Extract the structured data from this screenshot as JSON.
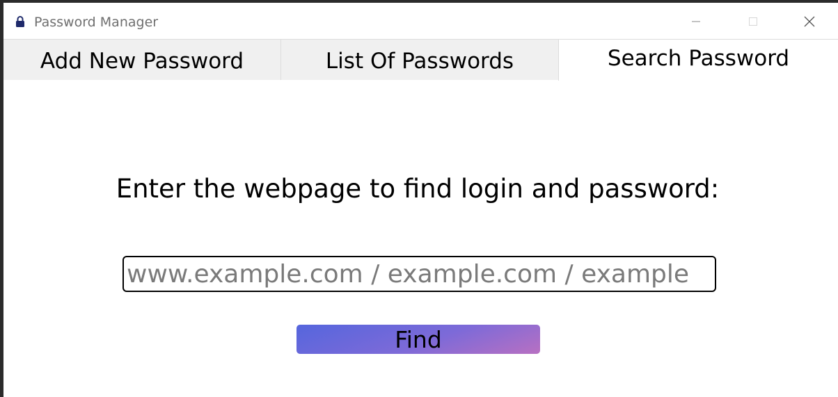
{
  "window": {
    "title": "Password Manager",
    "icon": "lock-icon",
    "controls": {
      "minimize": "minimize-icon",
      "maximize": "maximize-icon",
      "close": "close-icon"
    }
  },
  "tabs": [
    {
      "label": "Add New Password",
      "active": false
    },
    {
      "label": "List Of Passwords",
      "active": false
    },
    {
      "label": "Search Password",
      "active": true
    }
  ],
  "search": {
    "prompt": "Enter the webpage to find login and password:",
    "value": "",
    "placeholder": "www.example.com / example.com / example",
    "button_label": "Find"
  },
  "colors": {
    "button_gradient_start": "#5566dd",
    "button_gradient_end": "#b870c2",
    "icon_lock": "#1f2a6b"
  }
}
